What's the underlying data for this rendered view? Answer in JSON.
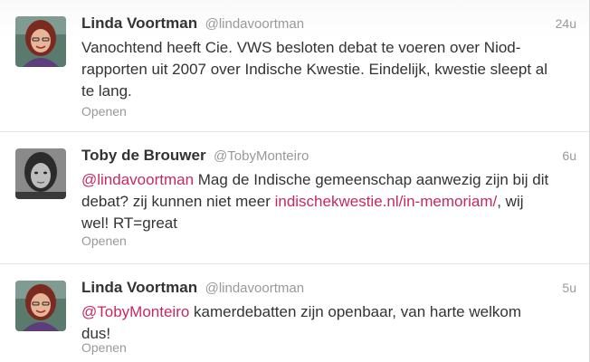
{
  "tweets": [
    {
      "name": "Linda Voortman",
      "handle": "@lindavoortman",
      "time": "24u",
      "text": "Vanochtend heeft Cie. VWS besloten debat te voeren over Niod-rapporten uit 2007 over Indische Kwestie. Eindelijk, kwestie sleept al te lang.",
      "open_label": "Openen",
      "avatar": "avatar-linda"
    },
    {
      "name": "Toby de Brouwer",
      "handle": "@TobyMonteiro",
      "time": "6u",
      "mention": "@lindavoortman",
      "text_part1": " Mag de Indische gemeenschap aanwezig zijn bij dit debat? zij kunnen niet meer ",
      "link": "indischekwestie.nl/in-memoriam/",
      "text_part2": ", wij wel! RT=great",
      "open_label": "Openen",
      "avatar": "avatar-toby"
    },
    {
      "name": "Linda Voortman",
      "handle": "@lindavoortman",
      "time": "5u",
      "mention": "@TobyMonteiro",
      "text_part1": " kamerdebatten zijn openbaar, van harte welkom dus!",
      "open_label": "Openen",
      "avatar": "avatar-linda"
    }
  ],
  "colors": {
    "link": "#c62a5d",
    "meta": "#999999",
    "text": "#333333"
  }
}
